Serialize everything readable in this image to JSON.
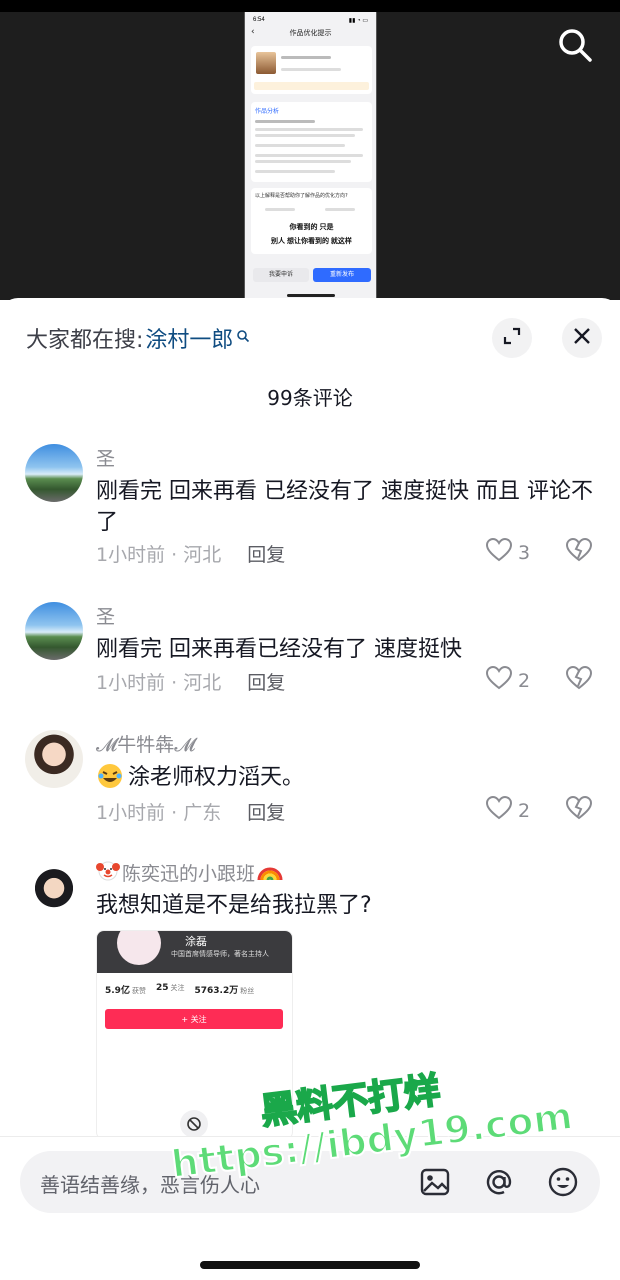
{
  "video": {
    "phone_status_time": "6:54",
    "phone_title": "作品优化提示",
    "phone_section": "作品分析",
    "phone_question": "以上解释是否帮助你了解作品的优化方向?",
    "phone_bold_line1": "你看到的 只是",
    "phone_bold_line2": "别人 想让你看到的 就这样",
    "phone_btn_left": "我要申诉",
    "phone_btn_right": "重新发布"
  },
  "header": {
    "search_prefix": "大家都在搜:",
    "search_keyword": "涂村一郎",
    "comments_count": "99条评论"
  },
  "comments": [
    {
      "username": "圣",
      "text": "刚看完 回来再看 已经没有了 速度挺快 而且 评论不了",
      "time_location": "1小时前 · 河北",
      "reply": "回复",
      "likes": "3"
    },
    {
      "username": "圣",
      "text": "刚看完 回来再看已经没有了 速度挺快",
      "time_location": "1小时前 · 河北",
      "reply": "回复",
      "likes": "2"
    },
    {
      "username": "𝓜牛牪犇𝓜",
      "text": "涂老师权力滔天。",
      "time_location": "1小时前 · 广东",
      "reply": "回复",
      "likes": "2"
    },
    {
      "username": "陈奕迅的小跟班",
      "text": "我想知道是不是给我拉黑了?",
      "image": {
        "name": "涂磊",
        "subtitle": "中国首席情感导师，著名主持人",
        "stat1_value": "5.9亿",
        "stat1_label": "获赞",
        "stat2_value": "25",
        "stat2_label": "关注",
        "stat3_value": "5763.2万",
        "stat3_label": "粉丝",
        "follow_label": "+ 关注"
      }
    }
  ],
  "input": {
    "placeholder": "善语结善缘，恶言伤人心"
  },
  "watermark": {
    "line1": "黑料不打烊",
    "line2": "https://ibdy19.com"
  },
  "icons": {
    "search": "search-icon",
    "expand": "expand-icon",
    "close": "close-icon",
    "like": "heart-icon",
    "dislike": "broken-heart-icon",
    "image": "image-icon",
    "mention": "at-icon",
    "emoji": "emoji-icon"
  }
}
